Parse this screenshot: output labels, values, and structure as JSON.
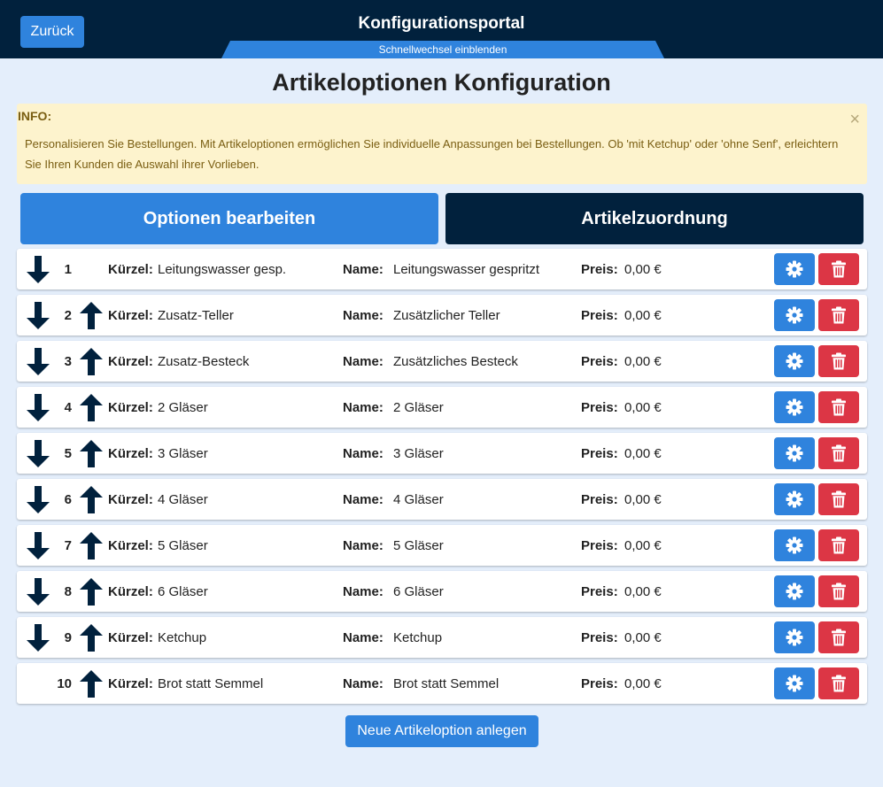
{
  "header": {
    "back_label": "Zurück",
    "title": "Konfigurationsportal",
    "quickswitch_label": "Schnellwechsel einblenden",
    "user_text": ""
  },
  "page_title": "Artikeloptionen Konfiguration",
  "info": {
    "heading": "INFO:",
    "text": "Personalisieren Sie Bestellungen. Mit Artikeloptionen ermöglichen Sie individuelle Anpassungen bei Bestellungen. Ob 'mit Ketchup' oder 'ohne Senf', erleichtern Sie Ihren Kunden die Auswahl ihrer Vorlieben.",
    "close_symbol": "×"
  },
  "tabs": {
    "edit_label": "Optionen bearbeiten",
    "assign_label": "Artikelzuordnung"
  },
  "labels": {
    "short": "Kürzel:",
    "name": "Name:",
    "price": "Preis:"
  },
  "options": [
    {
      "num": "1",
      "short": "Leitungswasser gesp.",
      "name": "Leitungswasser gespritzt",
      "price": "0,00 €",
      "down": true,
      "up": false
    },
    {
      "num": "2",
      "short": "Zusatz-Teller",
      "name": "Zusätzlicher Teller",
      "price": "0,00 €",
      "down": true,
      "up": true
    },
    {
      "num": "3",
      "short": "Zusatz-Besteck",
      "name": "Zusätzliches Besteck",
      "price": "0,00 €",
      "down": true,
      "up": true
    },
    {
      "num": "4",
      "short": "2 Gläser",
      "name": "2 Gläser",
      "price": "0,00 €",
      "down": true,
      "up": true
    },
    {
      "num": "5",
      "short": "3 Gläser",
      "name": "3 Gläser",
      "price": "0,00 €",
      "down": true,
      "up": true
    },
    {
      "num": "6",
      "short": "4 Gläser",
      "name": "4 Gläser",
      "price": "0,00 €",
      "down": true,
      "up": true
    },
    {
      "num": "7",
      "short": "5 Gläser",
      "name": "5 Gläser",
      "price": "0,00 €",
      "down": true,
      "up": true
    },
    {
      "num": "8",
      "short": "6 Gläser",
      "name": "6 Gläser",
      "price": "0,00 €",
      "down": true,
      "up": true
    },
    {
      "num": "9",
      "short": "Ketchup",
      "name": "Ketchup",
      "price": "0,00 €",
      "down": true,
      "up": true
    },
    {
      "num": "10",
      "short": "Brot statt Semmel",
      "name": "Brot statt Semmel",
      "price": "0,00 €",
      "down": false,
      "up": true
    }
  ],
  "new_option_label": "Neue Artikeloption anlegen",
  "colors": {
    "primary": "#2f83dd",
    "dark": "#01213d",
    "danger": "#dc3645",
    "info_bg": "#fdf3cd",
    "page_bg": "#e4eefb"
  },
  "icons": {
    "move_down": "arrow-down-icon",
    "move_up": "arrow-up-icon",
    "settings": "gear-icon",
    "delete": "trash-icon"
  }
}
